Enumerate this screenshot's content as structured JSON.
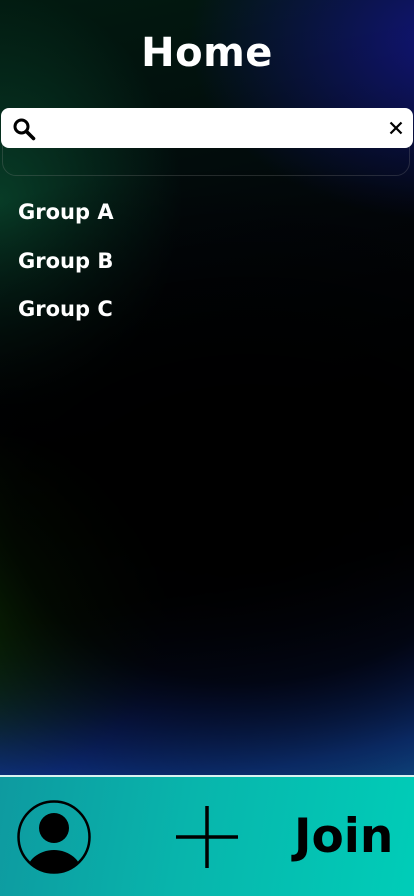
{
  "header": {
    "title": "Home"
  },
  "search": {
    "value": "",
    "placeholder": ""
  },
  "groups": [
    {
      "label": "Group A"
    },
    {
      "label": "Group B"
    },
    {
      "label": "Group C"
    }
  ],
  "bottom_nav": {
    "profile_icon": "user-avatar-icon",
    "add_icon": "plus-icon",
    "join_label": "Join"
  },
  "icons": {
    "search": "search-icon",
    "clear": "close-icon"
  },
  "colors": {
    "nav_bar": "#08b5ac",
    "search_bar": "#ffffff",
    "text": "#ffffff"
  }
}
